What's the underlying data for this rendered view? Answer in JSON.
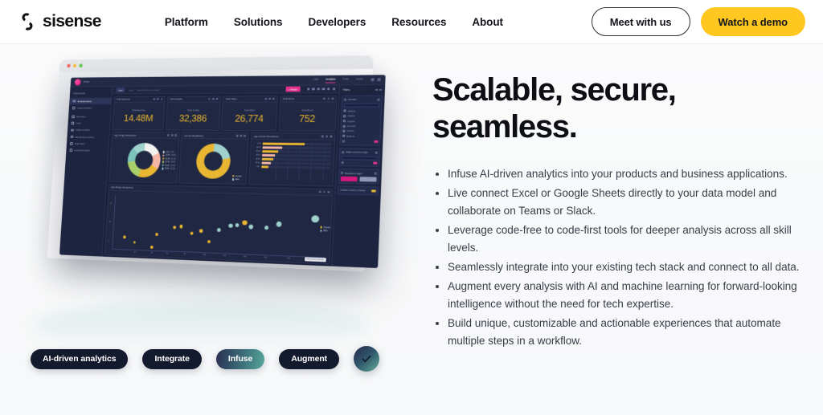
{
  "header": {
    "brand": "sisense",
    "brand_icon": "sisense-logo-icon",
    "nav": [
      {
        "label": "Platform"
      },
      {
        "label": "Solutions"
      },
      {
        "label": "Developers"
      },
      {
        "label": "Resources"
      },
      {
        "label": "About"
      }
    ],
    "actions": {
      "secondary_label": "Meet with us",
      "primary_label": "Watch a demo",
      "primary_color": "#ffc71f"
    }
  },
  "hero": {
    "headline": "Scalable, secure, seamless.",
    "bullets": [
      "Infuse AI-driven analytics into your products and business applications.",
      "Live connect Excel or Google Sheets directly to your data model and collaborate on Teams or Slack.",
      "Leverage code-free to code-first tools for deeper analysis across all skill levels.",
      "Seamlessly integrate into your existing tech stack and connect to all data.",
      "Augment every analysis with AI and machine learning for forward-looking intelligence without the need for tech expertise.",
      "Build unique, customizable and actionable experiences that automate multiple steps in a workflow."
    ]
  },
  "pills": [
    {
      "label": "AI-driven analytics",
      "style": "dark"
    },
    {
      "label": "Integrate",
      "style": "dark"
    },
    {
      "label": "Infuse",
      "style": "gradient"
    },
    {
      "label": "Augment",
      "style": "dark"
    }
  ],
  "check_badge": {
    "icon": "check-icon"
  },
  "dashboard": {
    "brand_home": "Home",
    "tabs": [
      {
        "label": "Data",
        "active": false
      },
      {
        "label": "Analytics",
        "active": true
      },
      {
        "label": "Pulse",
        "active": false
      },
      {
        "label": "Admin",
        "active": false
      }
    ],
    "sidebar": {
      "heading": "Dashboards",
      "items": [
        {
          "label": "All Dashboards",
          "active": true
        },
        {
          "label": "Usage Analytics",
          "active": false
        },
        {
          "label": "Revenues",
          "active": false
        },
        {
          "label": "Other",
          "active": false
        },
        {
          "label": "Usage Analysis",
          "active": false
        },
        {
          "label": "Sample  Ecommerce",
          "active": false
        },
        {
          "label": "Total Sales",
          "active": false
        },
        {
          "label": "Lead Generation",
          "active": false
        }
      ]
    },
    "toolbar": {
      "view_label": "View",
      "sales_label": "Sales",
      "date_label": "March 12th at 10:14AM",
      "widget_button": "+ Widget"
    },
    "kpis": [
      {
        "title": "Total Revenue",
        "caption": "Total Revenue",
        "value": "14.48M"
      },
      {
        "title": "Total Quality",
        "caption": "Total Quality",
        "value": "32,386"
      },
      {
        "title": "Total Sales",
        "caption": "Total Sales",
        "value": "26,774"
      },
      {
        "title": "Total Brand",
        "caption": "Total Brand",
        "value": "752"
      }
    ],
    "widgets": {
      "age_range": "Age Range Breakdown",
      "gender": "Gender Breakdown",
      "age_gender": "Age Gender Breakdown",
      "scatter": "Age Range Breakdown"
    },
    "age_legend": [
      {
        "label": "0-18",
        "value": "17.8",
        "color": "#f2f3f0"
      },
      {
        "label": "19-24",
        "value": "15.62",
        "color": "#f6b6a6"
      },
      {
        "label": "25-34",
        "value": "21.33",
        "color": "#e8b630"
      },
      {
        "label": "35-44",
        "value": "18.43",
        "color": "#a9cf6a"
      },
      {
        "label": "45-54",
        "value": "14.53",
        "color": "#79c3bb"
      },
      {
        "label": "55-64",
        "value": "12.29",
        "color": "#9fd2cd"
      }
    ],
    "gender_legend": [
      {
        "label": "Female",
        "value": "",
        "color": "#e8b630"
      },
      {
        "label": "Male",
        "value": "",
        "color": "#9fd2cd"
      }
    ],
    "filters": {
      "heading": "Filters",
      "country": {
        "title": "Country",
        "search_placeholder": "Start typing to search",
        "items": [
          "Albania",
          "Algeria",
          "Angola",
          "Armenia",
          "Austria",
          "Belarus"
        ]
      },
      "revenue": {
        "title": "Sales revenue range",
        "value_placeholder": "All"
      },
      "benefits": {
        "title": "Benefits in Apps",
        "apply_label": "Apply",
        "cancel_label": "Cancel"
      },
      "update_toggle": "Update on Every Change"
    },
    "powered_by": "Powered by Sisense"
  },
  "chart_data": [
    {
      "type": "pie",
      "title": "Age Range Breakdown",
      "categories": [
        "0-18",
        "19-24",
        "25-34",
        "35-44",
        "45-54",
        "55-64"
      ],
      "values": [
        17.8,
        15.62,
        21.33,
        18.43,
        14.53,
        12.29
      ],
      "colors": [
        "#f2f3f0",
        "#f6b6a6",
        "#e8b630",
        "#a9cf6a",
        "#79c3bb",
        "#9fd2cd"
      ],
      "legend": "right"
    },
    {
      "type": "pie",
      "title": "Gender Breakdown",
      "categories": [
        "Female",
        "Male"
      ],
      "values": [
        78,
        22
      ],
      "colors": [
        "#e8b630",
        "#9fd2cd"
      ],
      "legend": "bottom-right"
    },
    {
      "type": "bar",
      "title": "Age Gender Breakdown",
      "orientation": "horizontal",
      "categories": [
        "0-18",
        "19-24",
        "25-34",
        "35-44",
        "45-54",
        "55-64",
        "65+"
      ],
      "series": [
        {
          "name": "Female",
          "values": [
            62,
            30,
            24,
            20,
            17,
            14,
            10
          ],
          "color": "#e8b630"
        },
        {
          "name": "Male",
          "values": [
            22,
            14,
            12,
            11,
            9,
            8,
            6
          ],
          "color": "#f6b6a6"
        }
      ],
      "grid": true
    },
    {
      "type": "scatter",
      "title": "Age Range Breakdown",
      "xlabel": "",
      "ylabel": "",
      "xticks": [
        "0",
        "20",
        "40",
        "60",
        "80",
        "100",
        "120",
        "140",
        "160",
        "180",
        "200",
        "220",
        "240",
        "260",
        "280"
      ],
      "yticks": [
        "0",
        "20",
        "40"
      ],
      "points": [
        {
          "x": 12,
          "y": 16,
          "r": 2.0,
          "color": "#e8b630"
        },
        {
          "x": 20,
          "y": 12,
          "r": 1.8,
          "color": "#e8b630"
        },
        {
          "x": 32,
          "y": 9,
          "r": 1.9,
          "color": "#e8b630"
        },
        {
          "x": 36,
          "y": 20,
          "r": 2.1,
          "color": "#e8b630"
        },
        {
          "x": 48,
          "y": 27,
          "r": 2.3,
          "color": "#e8b630"
        },
        {
          "x": 52,
          "y": 29,
          "r": 2.3,
          "color": "#e8b630"
        },
        {
          "x": 60,
          "y": 22,
          "r": 2.2,
          "color": "#e8b630"
        },
        {
          "x": 66,
          "y": 25,
          "r": 2.4,
          "color": "#e8b630"
        },
        {
          "x": 72,
          "y": 16,
          "r": 2.2,
          "color": "#e8b630"
        },
        {
          "x": 78,
          "y": 26,
          "r": 2.4,
          "color": "#9fd2cd"
        },
        {
          "x": 86,
          "y": 31,
          "r": 2.8,
          "color": "#9fd2cd"
        },
        {
          "x": 92,
          "y": 32,
          "r": 2.6,
          "color": "#9fd2cd"
        },
        {
          "x": 96,
          "y": 34,
          "r": 3.2,
          "color": "#e8b630"
        },
        {
          "x": 100,
          "y": 31,
          "r": 3.0,
          "color": "#9fd2cd"
        },
        {
          "x": 112,
          "y": 30,
          "r": 2.2,
          "color": "#9fd2cd"
        },
        {
          "x": 120,
          "y": 34,
          "r": 3.6,
          "color": "#9fd2cd"
        },
        {
          "x": 150,
          "y": 40,
          "r": 4.6,
          "color": "#9fd2cd"
        }
      ]
    }
  ]
}
